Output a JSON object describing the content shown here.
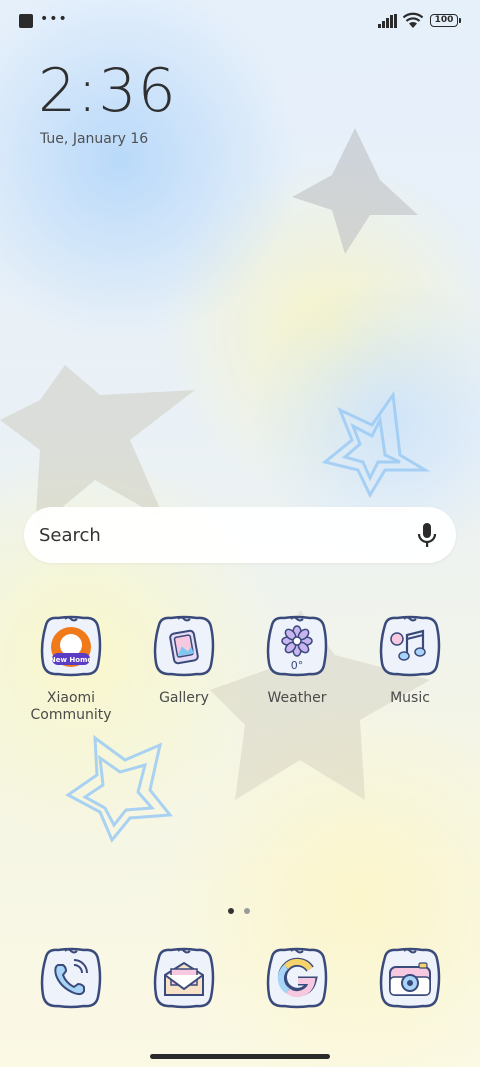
{
  "status_bar": {
    "more_label": "•••",
    "battery": "100",
    "icons": [
      "app-notification-icon",
      "more-icon",
      "signal-icon",
      "wifi-icon",
      "battery-icon"
    ]
  },
  "lock": {
    "time": "2:36",
    "date": "Tue, January 16"
  },
  "search": {
    "label": "Search",
    "icon": "microphone-icon"
  },
  "apps": [
    {
      "label": "Xiaomi\nCommunity",
      "icon": "xiaomi-community-icon",
      "badge": "New Home"
    },
    {
      "label": "Gallery",
      "icon": "gallery-icon"
    },
    {
      "label": "Weather",
      "icon": "weather-icon",
      "temp": "0°"
    },
    {
      "label": "Music",
      "icon": "music-icon"
    }
  ],
  "dock": [
    {
      "icon": "phone-icon"
    },
    {
      "icon": "messages-icon"
    },
    {
      "icon": "google-icon"
    },
    {
      "icon": "camera-icon"
    }
  ],
  "page_indicator": {
    "pages": 2,
    "current": 1
  },
  "colors": {
    "icon_outline": "#3a4a7a",
    "icon_fill": "#eef2fb",
    "active_dot": "#333333",
    "inactive_dot": "#9a9a9a"
  }
}
